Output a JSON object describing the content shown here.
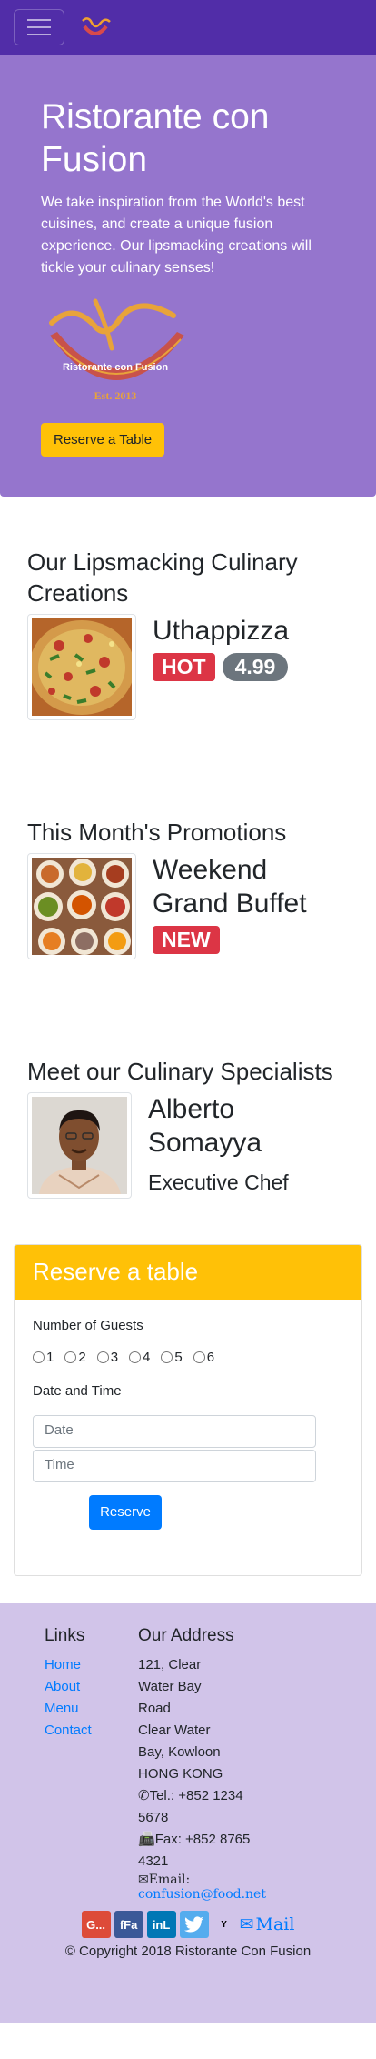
{
  "navbar": {
    "logo": "ristorante-logo"
  },
  "jumbotron": {
    "title": "Ristorante con Fusion",
    "text": "We take inspiration from the World's best cuisines, and create a unique fusion experience. Our lipsmacking creations will tickle your culinary senses!",
    "logo_text": "Ristorante con Fusion",
    "logo_est": "Est. 2013",
    "button": "Reserve a Table"
  },
  "dish": {
    "heading": "Our Lipsmacking Culinary Creations",
    "name": "Uthappizza",
    "badge": "HOT",
    "price": "4.99"
  },
  "promotion": {
    "heading": "This Month's Promotions",
    "name": "Weekend Grand Buffet",
    "badge": "NEW"
  },
  "leader": {
    "heading": "Meet our Culinary Specialists",
    "name": "Alberto Somayya",
    "designation": "Executive Chef"
  },
  "reserve": {
    "header": "Reserve a table",
    "guests_label": "Number of Guests",
    "guests": [
      "1",
      "2",
      "3",
      "4",
      "5",
      "6"
    ],
    "datetime_label": "Date and Time",
    "date_placeholder": "Date",
    "time_placeholder": "Time",
    "submit": "Reserve"
  },
  "footer": {
    "links_heading": "Links",
    "links": [
      "Home",
      "About",
      "Menu",
      "Contact"
    ],
    "address_heading": "Our Address",
    "address": [
      "121, Clear",
      "Water Bay",
      "Road",
      "Clear Water",
      "Bay, Kowloon",
      "HONG KONG"
    ],
    "tel": "Tel.: +852 1234 5678",
    "fax": "Fax: +852 8765 4321",
    "email_label": "Email:",
    "email": "confusion@food.net",
    "social": [
      "G...",
      "fFa",
      "inL",
      "Y"
    ],
    "mail": "Mail",
    "copyright": "© Copyright 2018 Ristorante Con Fusion"
  },
  "colors": {
    "primary_dark": "#512da8",
    "primary": "#9575cd",
    "primary_light": "#d1c4e9",
    "warning": "#ffc107",
    "danger": "#dc3545",
    "secondary": "#6c757d",
    "link": "#007bff"
  }
}
